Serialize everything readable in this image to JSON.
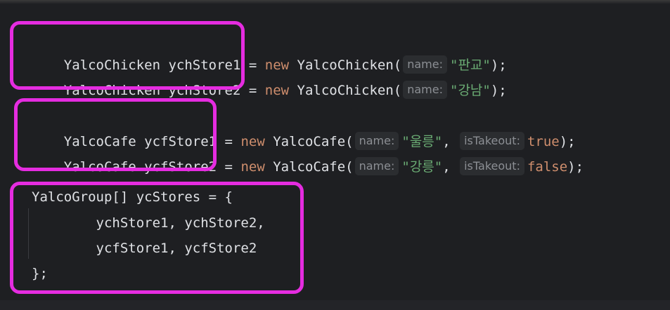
{
  "editor": {
    "lines": [
      {
        "id": "line1",
        "type": "chicken",
        "decl": "YalcoChicken ychStore1 = ",
        "kw": "new",
        "ctor": " YalcoChicken(",
        "hint1": "name:",
        "arg1": "\"판교\"",
        "end": ");"
      },
      {
        "id": "line2",
        "type": "chicken",
        "decl": "YalcoChicken ychStore2 = ",
        "kw": "new",
        "ctor": " YalcoChicken(",
        "hint1": "name:",
        "arg1": "\"강남\"",
        "end": ");"
      },
      {
        "id": "line3",
        "type": "cafe",
        "decl": "YalcoCafe ycfStore1 = ",
        "kw": "new",
        "ctor": " YalcoCafe(",
        "hint1": "name:",
        "arg1": "\"울릉\"",
        "sep": ", ",
        "hint2": "isTakeout:",
        "arg2": "true",
        "end": ");"
      },
      {
        "id": "line4",
        "type": "cafe",
        "decl": "YalcoCafe ycfStore2 = ",
        "kw": "new",
        "ctor": " YalcoCafe(",
        "hint1": "name:",
        "arg1": "\"강릉\"",
        "sep": ", ",
        "hint2": "isTakeout:",
        "arg2": "false",
        "end": ");"
      },
      {
        "id": "line5",
        "type": "plain",
        "text": "YalcoGroup[] ycStores = {"
      },
      {
        "id": "line6",
        "type": "plain",
        "text": "        ychStore1, ychStore2,"
      },
      {
        "id": "line7",
        "type": "plain",
        "text": "        ycfStore1, ycfStore2"
      },
      {
        "id": "line8",
        "type": "plain",
        "text": "};"
      }
    ]
  },
  "colors": {
    "background": "#1e1f22",
    "keyword": "#cf8e6d",
    "string_literal": "#6aab73",
    "identifier": "#dfe1e5",
    "inlay_hint_text": "#8c8f94",
    "inlay_hint_bg": "#2b2d30",
    "highlight_box": "#e52ce0"
  }
}
